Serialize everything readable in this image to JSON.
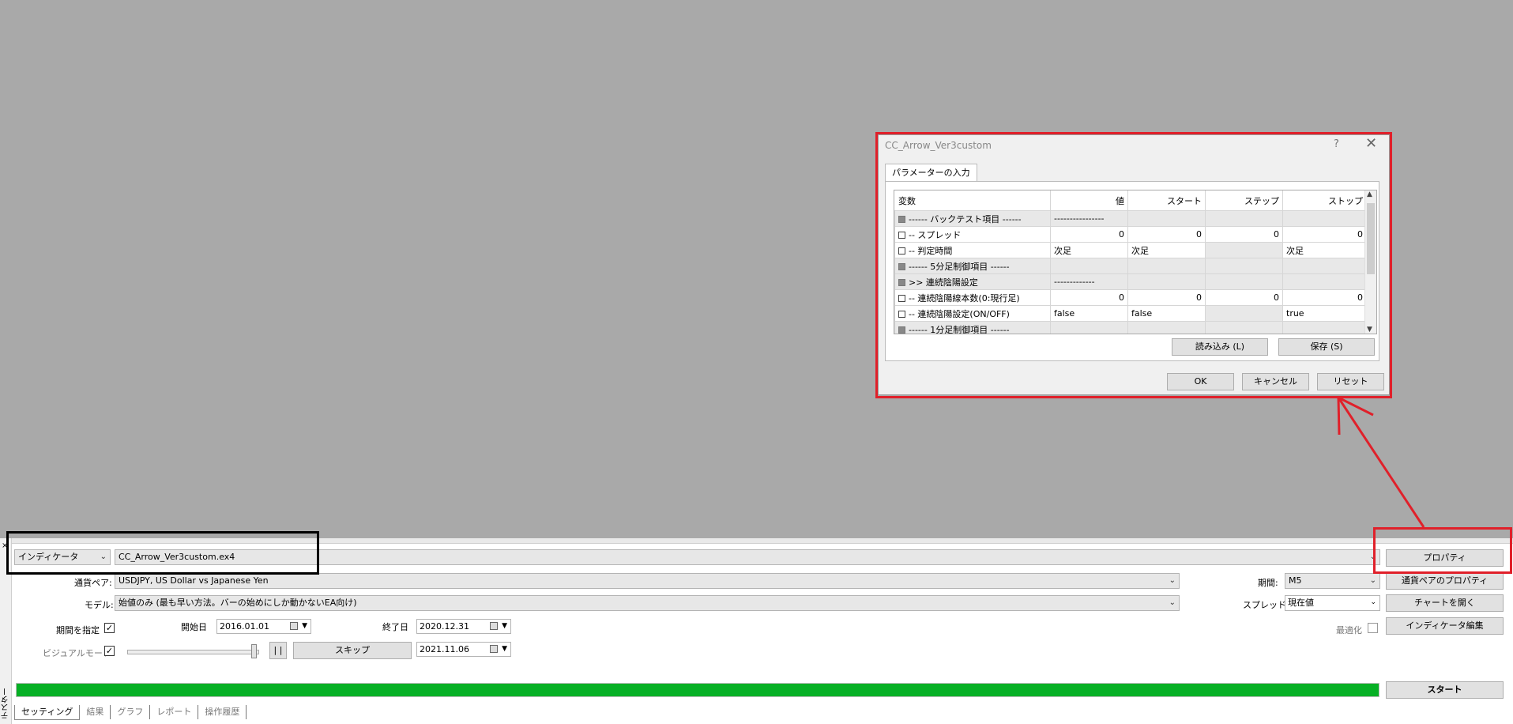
{
  "dialog": {
    "title": "CC_Arrow_Ver3custom",
    "help": "?",
    "close": "✕",
    "tab": "パラメーターの入力",
    "columns": [
      "変数",
      "値",
      "スタート",
      "ステップ",
      "ストップ"
    ],
    "rows": [
      {
        "name": "------ バックテスト項目 ------",
        "section": true,
        "value": "----------------",
        "start": "",
        "step": "",
        "stop": ""
      },
      {
        "name": "-- スプレッド",
        "section": false,
        "value": "0",
        "start": "0",
        "step": "0",
        "stop": "0",
        "numeric": true
      },
      {
        "name": "-- 判定時間",
        "section": false,
        "value": "次足",
        "start": "次足",
        "step": "",
        "stop": "次足"
      },
      {
        "name": "------ 5分足制御項目 ------",
        "section": true,
        "value": "",
        "start": "",
        "step": "",
        "stop": ""
      },
      {
        "name": ">> 連続陰陽設定",
        "section": true,
        "value": "-------------",
        "start": "",
        "step": "",
        "stop": ""
      },
      {
        "name": "-- 連続陰陽線本数(0:現行足)",
        "section": false,
        "value": "0",
        "start": "0",
        "step": "0",
        "stop": "0",
        "numeric": true
      },
      {
        "name": "-- 連続陰陽設定(ON/OFF)",
        "section": false,
        "value": "false",
        "start": "false",
        "step": "",
        "stop": "true"
      },
      {
        "name": "------ 1分足制御項目 ------",
        "section": true,
        "value": "",
        "start": "",
        "step": "",
        "stop": ""
      }
    ],
    "load_button": "読み込み (L)",
    "save_button": "保存 (S)",
    "ok_button": "OK",
    "cancel_button": "キャンセル",
    "reset_button": "リセット"
  },
  "tester": {
    "type_select": "インディケータ",
    "program_select": "CC_Arrow_Ver3custom.ex4",
    "properties_button": "プロパティ",
    "symbol_label": "通貨ペア:",
    "symbol_value": "USDJPY, US Dollar vs Japanese Yen",
    "period_label": "期間:",
    "period_value": "M5",
    "symbol_props_button": "通貨ペアのプロパティ",
    "model_label": "モデル:",
    "model_value": "始値のみ (最も早い方法。バーの始めにしか動かないEA向け)",
    "spread_label": "スプレッド:",
    "spread_value": "現在値",
    "open_chart_button": "チャートを開く",
    "use_date_label": "期間を指定",
    "use_date_checked": "✓",
    "start_date_label": "開始日",
    "start_date": "2016.01.01",
    "end_date_label": "終了日",
    "end_date": "2020.12.31",
    "optimization_label": "最適化",
    "edit_indicator_button": "インディケータ編集",
    "visual_mode_label": "ビジュアルモード",
    "visual_mode_checked": "✓",
    "pause_button": "| |",
    "skip_button": "スキップ",
    "skip_date": "2021.11.06",
    "progress": 1.0,
    "start_button": "スタート",
    "tabs": [
      "セッティング",
      "結果",
      "グラフ",
      "レポート",
      "操作履歴"
    ],
    "side_title": "テスター",
    "side_close": "×"
  },
  "colors": {
    "highlight": "#e0202a",
    "progress": "#06b025"
  }
}
